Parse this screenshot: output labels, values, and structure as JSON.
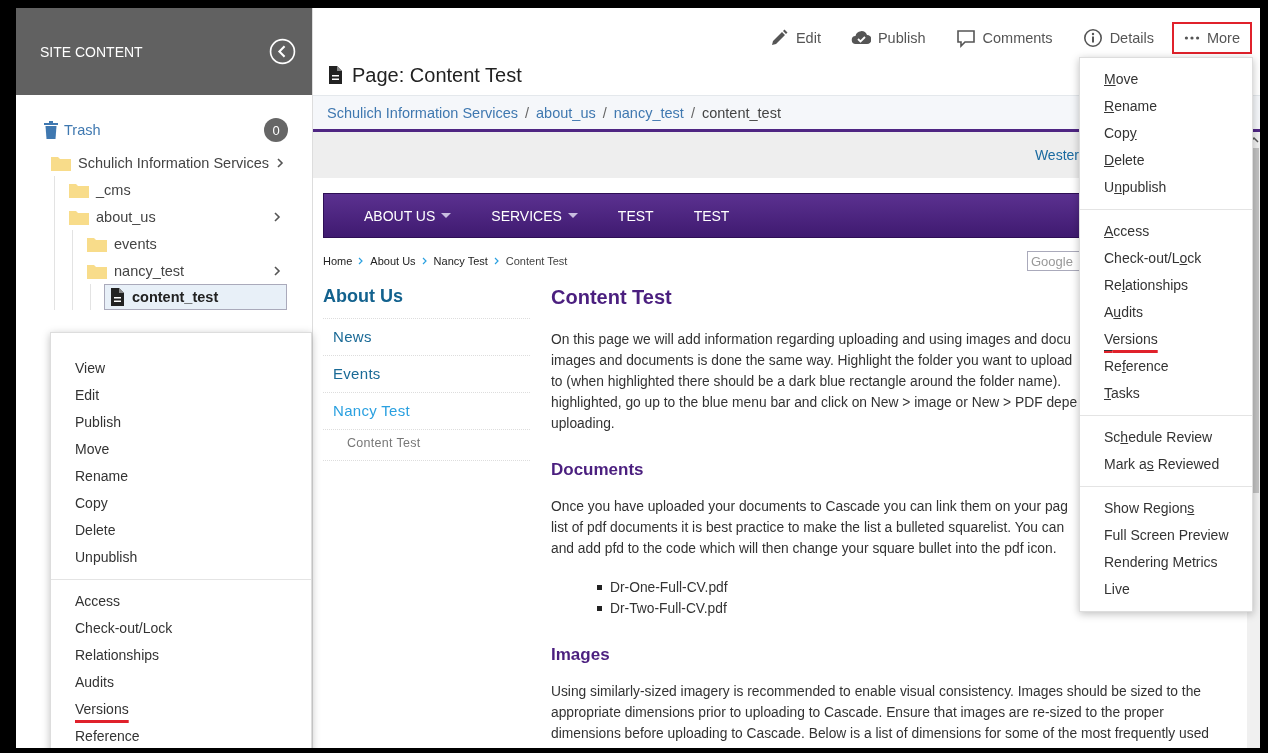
{
  "sidebar": {
    "title": "SITE CONTENT",
    "trash": {
      "label": "Trash",
      "count": "0"
    },
    "tree": [
      {
        "label": "Schulich Information Services",
        "kind": "folder",
        "expandable": true,
        "selected": false,
        "children": [
          {
            "label": "_cms",
            "kind": "folder",
            "expandable": false,
            "selected": false
          },
          {
            "label": "about_us",
            "kind": "folder",
            "expandable": true,
            "selected": false,
            "children": [
              {
                "label": "events",
                "kind": "folder",
                "expandable": false,
                "selected": false
              },
              {
                "label": "nancy_test",
                "kind": "folder",
                "expandable": true,
                "selected": false,
                "children": [
                  {
                    "label": "content_test",
                    "kind": "page",
                    "expandable": false,
                    "selected": true
                  }
                ]
              }
            ]
          }
        ]
      }
    ]
  },
  "context_menu": {
    "groups": [
      [
        {
          "label": "View",
          "annotated": false
        },
        {
          "label": "Edit",
          "annotated": false
        },
        {
          "label": "Publish",
          "annotated": false
        },
        {
          "label": "Move",
          "annotated": false
        },
        {
          "label": "Rename",
          "annotated": false
        },
        {
          "label": "Copy",
          "annotated": false
        },
        {
          "label": "Delete",
          "annotated": false
        },
        {
          "label": "Unpublish",
          "annotated": false
        }
      ],
      [
        {
          "label": "Access",
          "annotated": false
        },
        {
          "label": "Check-out/Lock",
          "annotated": false
        },
        {
          "label": "Relationships",
          "annotated": false
        },
        {
          "label": "Audits",
          "annotated": false
        },
        {
          "label": "Versions",
          "annotated": true
        },
        {
          "label": "Reference",
          "annotated": false
        }
      ]
    ]
  },
  "toolbar": [
    {
      "label": "Edit",
      "kind": "edit",
      "highlighted": false
    },
    {
      "label": "Publish",
      "kind": "publish",
      "highlighted": false
    },
    {
      "label": "Comments",
      "kind": "comments",
      "highlighted": false
    },
    {
      "label": "Details",
      "kind": "details",
      "highlighted": false
    },
    {
      "label": "More",
      "kind": "more",
      "highlighted": true
    }
  ],
  "page_title": "Page: Content Test",
  "breadcrumb": {
    "separator": "/",
    "items": [
      {
        "label": "Schulich Information Services",
        "current": false
      },
      {
        "label": "about_us",
        "current": false
      },
      {
        "label": "nancy_test",
        "current": false
      },
      {
        "label": "content_test",
        "current": true
      }
    ]
  },
  "more_menu": {
    "groups": [
      [
        {
          "key": "M",
          "post": "ove",
          "annotated": false
        },
        {
          "key": "R",
          "post": "ename",
          "annotated": false
        },
        {
          "pre": "Cop",
          "key": "y",
          "annotated": false
        },
        {
          "key": "D",
          "post": "elete",
          "annotated": false
        },
        {
          "pre": "U",
          "key": "n",
          "post": "publish",
          "annotated": false
        }
      ],
      [
        {
          "key": "A",
          "post": "ccess",
          "annotated": false
        },
        {
          "pre": "Check-out/L",
          "key": "o",
          "post": "ck",
          "annotated": false
        },
        {
          "pre": "Re",
          "key": "l",
          "post": "ationships",
          "annotated": false
        },
        {
          "pre": "A",
          "key": "u",
          "post": "dits",
          "annotated": false
        },
        {
          "key": "V",
          "post": "ersions",
          "annotated": true
        },
        {
          "pre": "Re",
          "key": "f",
          "post": "erence",
          "annotated": false
        },
        {
          "key": "T",
          "post": "asks",
          "annotated": false
        }
      ],
      [
        {
          "pre": "Sc",
          "key": "h",
          "post": "edule Review",
          "annotated": false
        },
        {
          "pre": "Mark a",
          "key": "s",
          "post": " Reviewed",
          "annotated": false
        }
      ],
      [
        {
          "pre": "Show Region",
          "key": "s",
          "annotated": false
        },
        {
          "pre": "Full Screen Preview",
          "annotated": false
        },
        {
          "pre": "Rendering Metrics",
          "annotated": false
        },
        {
          "pre": "Live",
          "annotated": false
        }
      ]
    ]
  },
  "preview": {
    "top_link": "Wester",
    "nav": [
      {
        "label": "ABOUT US",
        "dropdown": true
      },
      {
        "label": "SERVICES",
        "dropdown": true
      },
      {
        "label": "TEST",
        "dropdown": false
      },
      {
        "label": "TEST",
        "dropdown": false
      }
    ],
    "site_breadcrumb": [
      "Home",
      "About Us",
      "Nancy Test",
      "Content Test"
    ],
    "search_placeholder": "Google",
    "side_nav": {
      "title": "About Us",
      "items": [
        {
          "label": "News",
          "current": false,
          "sub": false
        },
        {
          "label": "Events",
          "current": false,
          "sub": false
        },
        {
          "label": "Nancy Test",
          "current": true,
          "sub": false
        },
        {
          "label": "Content Test",
          "current": false,
          "sub": true
        }
      ]
    },
    "title": "Content Test",
    "blocks": [
      {
        "kind": "paragraph",
        "lines": [
          "On this page we will add information regarding uploading and using images and docu",
          "images and documents is done the same way. Highlight the folder you want to upload",
          "to (when highlighted there should be a dark blue rectangle around the folder name).",
          "highlighted, go up to the blue menu bar and click on New > image or New > PDF depe",
          "uploading."
        ]
      },
      {
        "kind": "heading",
        "text": "Documents"
      },
      {
        "kind": "paragraph",
        "lines": [
          "Once you have uploaded your documents to Cascade you can link them on your pag",
          "list of pdf documents it is best practice to make the list a bulleted squarelist. You can",
          "and add pfd to the code which will then change your square bullet into the pdf icon."
        ]
      },
      {
        "kind": "list",
        "items": [
          "Dr-One-Full-CV.pdf",
          "Dr-Two-Full-CV.pdf"
        ]
      },
      {
        "kind": "heading",
        "text": "Images"
      },
      {
        "kind": "paragraph",
        "lines": [
          "Using similarly-sized imagery is recommended to enable visual consistency. Images should be sized to the",
          "appropriate dimensions prior to uploading to Cascade. Ensure that images are re-sized to the proper",
          "dimensions before uploading to Cascade. Below is a list of dimensions for some of the most frequently used"
        ]
      }
    ]
  }
}
